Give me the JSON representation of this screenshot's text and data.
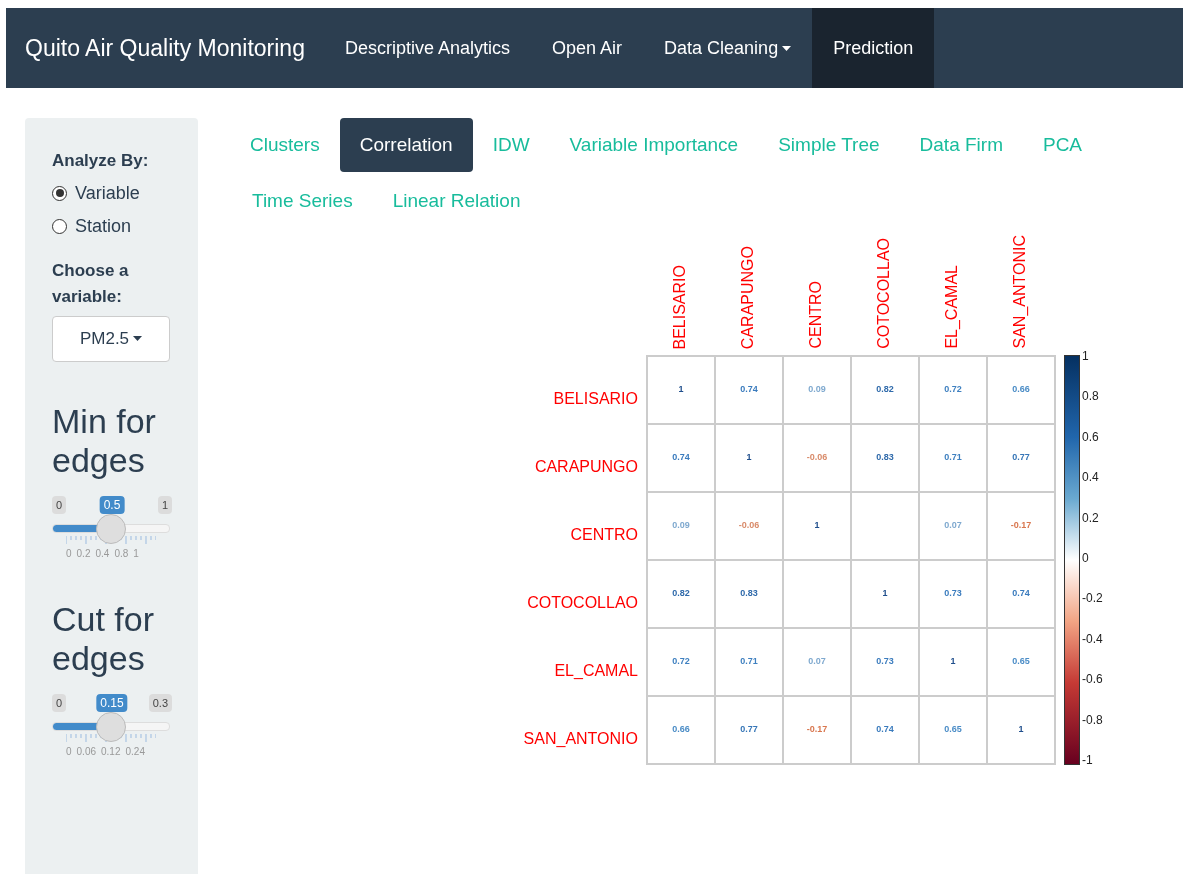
{
  "navbar": {
    "brand": "Quito Air Quality Monitoring",
    "items": [
      {
        "label": "Descriptive Analytics",
        "kind": "link",
        "selected": false
      },
      {
        "label": "Open Air",
        "kind": "link",
        "selected": false
      },
      {
        "label": "Data Cleaning",
        "kind": "dropdown",
        "selected": false
      },
      {
        "label": "Prediction",
        "kind": "link",
        "selected": true
      }
    ]
  },
  "sidebar": {
    "analyze_label": "Analyze By:",
    "radios": [
      {
        "label": "Variable",
        "selected": true
      },
      {
        "label": "Station",
        "selected": false
      }
    ],
    "variable_label": "Choose a variable:",
    "variable_value": "PM2.5",
    "sliders": [
      {
        "title": "Min for edges",
        "min": "0",
        "max": "1",
        "value": "0.5",
        "level": 0.5,
        "ticks": [
          "0",
          "0.2",
          "0.4",
          "0.8",
          "1"
        ]
      },
      {
        "title": "Cut for edges",
        "min": "0",
        "max": "0.3",
        "value": "0.15",
        "level": 0.5,
        "ticks": [
          "0",
          "0.06",
          "0.12",
          "0.24"
        ]
      }
    ]
  },
  "tabs": [
    {
      "label": "Clusters",
      "selected": false
    },
    {
      "label": "Correlation",
      "selected": true
    },
    {
      "label": "IDW",
      "selected": false
    },
    {
      "label": "Variable Importance",
      "selected": false
    },
    {
      "label": "Simple Tree",
      "selected": false
    },
    {
      "label": "Data Firm",
      "selected": false
    },
    {
      "label": "PCA",
      "selected": false
    },
    {
      "label": "Time Series",
      "selected": false
    },
    {
      "label": "Linear Relation",
      "selected": false
    }
  ],
  "correlation": {
    "columns": [
      "BELISARIO",
      "CARAPUNGO",
      "CENTRO",
      "COTOCOLLAO",
      "EL_CAMAL",
      "SAN_ANTONIC"
    ],
    "rows": [
      {
        "label": "BELISARIO",
        "cells": [
          {
            "text": "1",
            "color": "#1f4e8c"
          },
          {
            "text": "0.74",
            "color": "#3a7bbd"
          },
          {
            "text": "0.09",
            "color": "#7fa9cf"
          },
          {
            "text": "0.82",
            "color": "#2f6aab"
          },
          {
            "text": "0.72",
            "color": "#3f80c0"
          },
          {
            "text": "0.66",
            "color": "#4a8cc6"
          }
        ]
      },
      {
        "label": "CARAPUNGO",
        "cells": [
          {
            "text": "0.74",
            "color": "#3a7bbd"
          },
          {
            "text": "1",
            "color": "#1f4e8c"
          },
          {
            "text": "-0.06",
            "color": "#d98b6a"
          },
          {
            "text": "0.83",
            "color": "#2f6aab"
          },
          {
            "text": "0.71",
            "color": "#3f80c0"
          },
          {
            "text": "0.77",
            "color": "#3676b7"
          }
        ]
      },
      {
        "label": "CENTRO",
        "cells": [
          {
            "text": "0.09",
            "color": "#7fa9cf"
          },
          {
            "text": "-0.06",
            "color": "#d98b6a"
          },
          {
            "text": "1",
            "color": "#1f4e8c"
          },
          null,
          {
            "text": "0.07",
            "color": "#7fa9cf"
          },
          {
            "text": "-0.17",
            "color": "#d9774f"
          }
        ]
      },
      {
        "label": "COTOCOLLAO",
        "cells": [
          {
            "text": "0.82",
            "color": "#2f6aab"
          },
          {
            "text": "0.83",
            "color": "#2f6aab"
          },
          null,
          {
            "text": "1",
            "color": "#1f4e8c"
          },
          {
            "text": "0.73",
            "color": "#3b7cbe"
          },
          {
            "text": "0.74",
            "color": "#3a7bbd"
          }
        ]
      },
      {
        "label": "EL_CAMAL",
        "cells": [
          {
            "text": "0.72",
            "color": "#3f80c0"
          },
          {
            "text": "0.71",
            "color": "#3f80c0"
          },
          {
            "text": "0.07",
            "color": "#7fa9cf"
          },
          {
            "text": "0.73",
            "color": "#3b7cbe"
          },
          {
            "text": "1",
            "color": "#1f4e8c"
          },
          {
            "text": "0.65",
            "color": "#4b8dc7"
          }
        ]
      },
      {
        "label": "SAN_ANTONIO",
        "cells": [
          {
            "text": "0.66",
            "color": "#4a8cc6"
          },
          {
            "text": "0.77",
            "color": "#3676b7"
          },
          {
            "text": "-0.17",
            "color": "#d9774f"
          },
          {
            "text": "0.74",
            "color": "#3a7bbd"
          },
          {
            "text": "0.65",
            "color": "#4b8dc7"
          },
          {
            "text": "1",
            "color": "#1f4e8c"
          }
        ]
      }
    ],
    "legend_ticks": [
      "1",
      "0.8",
      "0.6",
      "0.4",
      "0.2",
      "0",
      "-0.2",
      "-0.4",
      "-0.6",
      "-0.8",
      "-1"
    ]
  }
}
